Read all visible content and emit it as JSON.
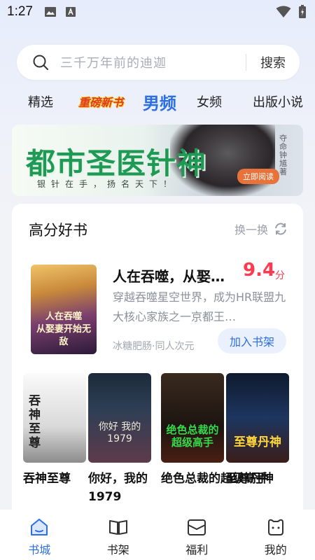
{
  "status": {
    "time": "1:27"
  },
  "search": {
    "placeholder": "三千万年前的迪迦",
    "button": "搜索"
  },
  "tabs": [
    {
      "label": "精选"
    },
    {
      "label": "重磅新书"
    },
    {
      "label": "男频",
      "active": true
    },
    {
      "label": "女频"
    },
    {
      "label": "出版小说"
    }
  ],
  "banner": {
    "title": "都市圣医针神",
    "subtitle": "银针在手，扬名天下！",
    "author_vertical": "夺命钟馗著",
    "badge": "立即阅读"
  },
  "section": {
    "title": "高分好书",
    "refresh_label": "换一换"
  },
  "featured": {
    "title": "人在吞噬，从娶…",
    "score": "9.4",
    "score_unit": "分",
    "description": "穿越吞噬星空世界，成为HR联盟九大核心家族之一京都王…",
    "meta": "冰糖肥肠·同人次元",
    "add_button": "加入书架",
    "cover_text": "人在吞噬\n从娶妻开始无敌"
  },
  "books": [
    {
      "title": "吞神至尊",
      "cover_text": "吞神至尊"
    },
    {
      "title": "你好，我的1979",
      "cover_text": "你好 我的1979"
    },
    {
      "title": "绝色总裁的超级高手",
      "cover_text": "绝色总裁的超级高手"
    },
    {
      "title": "至尊丹神",
      "cover_text": "至尊丹神"
    }
  ],
  "nav": [
    {
      "label": "书城",
      "active": true
    },
    {
      "label": "书架"
    },
    {
      "label": "福利"
    },
    {
      "label": "我的"
    }
  ],
  "colors": {
    "accent": "#2b6ee6",
    "score": "#ff3a4e",
    "banner_title": "#1f9a55"
  }
}
